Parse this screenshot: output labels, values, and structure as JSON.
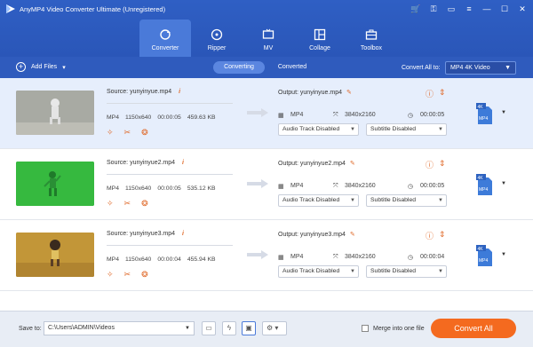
{
  "window": {
    "title": "AnyMP4 Video Converter Ultimate (Unregistered)"
  },
  "tabs": [
    {
      "label": "Converter",
      "icon": "refresh-icon",
      "active": true
    },
    {
      "label": "Ripper",
      "icon": "disc-icon",
      "active": false
    },
    {
      "label": "MV",
      "icon": "tv-icon",
      "active": false
    },
    {
      "label": "Collage",
      "icon": "collage-icon",
      "active": false
    },
    {
      "label": "Toolbox",
      "icon": "toolbox-icon",
      "active": false
    }
  ],
  "toolbar": {
    "add_files_label": "Add Files",
    "segment_converting": "Converting",
    "segment_converted": "Converted",
    "convert_all_to_label": "Convert All to:",
    "convert_all_format": "MP4 4K Video"
  },
  "files": [
    {
      "source": "Source: yunyinyue.mp4",
      "format": "MP4",
      "resolution": "1150x640",
      "duration": "00:00:05",
      "size": "459.63 KB",
      "output": "Output: yunyinyue.mp4",
      "out_format": "MP4",
      "out_resolution": "3840x2160",
      "out_duration": "00:00:05",
      "audio": "Audio Track Disabled",
      "subtitle": "Subtitle Disabled",
      "thumb_color": "#a9aaa2",
      "selected": true
    },
    {
      "source": "Source: yunyinyue2.mp4",
      "format": "MP4",
      "resolution": "1150x640",
      "duration": "00:00:05",
      "size": "535.12 KB",
      "output": "Output: yunyinyue2.mp4",
      "out_format": "MP4",
      "out_resolution": "3840x2160",
      "out_duration": "00:00:05",
      "audio": "Audio Track Disabled",
      "subtitle": "Subtitle Disabled",
      "thumb_color": "#35b83e",
      "selected": false
    },
    {
      "source": "Source: yunyinyue3.mp4",
      "format": "MP4",
      "resolution": "1150x640",
      "duration": "00:00:04",
      "size": "455.94 KB",
      "output": "Output: yunyinyue3.mp4",
      "out_format": "MP4",
      "out_resolution": "3840x2160",
      "out_duration": "00:00:04",
      "audio": "Audio Track Disabled",
      "subtitle": "Subtitle Disabled",
      "thumb_color": "#c09436",
      "selected": false
    }
  ],
  "bottom": {
    "save_to_label": "Save to:",
    "save_path": "C:\\Users\\ADMIN\\Videos",
    "merge_label": "Merge into one file",
    "convert_all_button": "Convert All"
  },
  "colors": {
    "accent_blue": "#2f5bbd",
    "accent_orange": "#f46a1f",
    "selected_row": "#e6eefc"
  }
}
